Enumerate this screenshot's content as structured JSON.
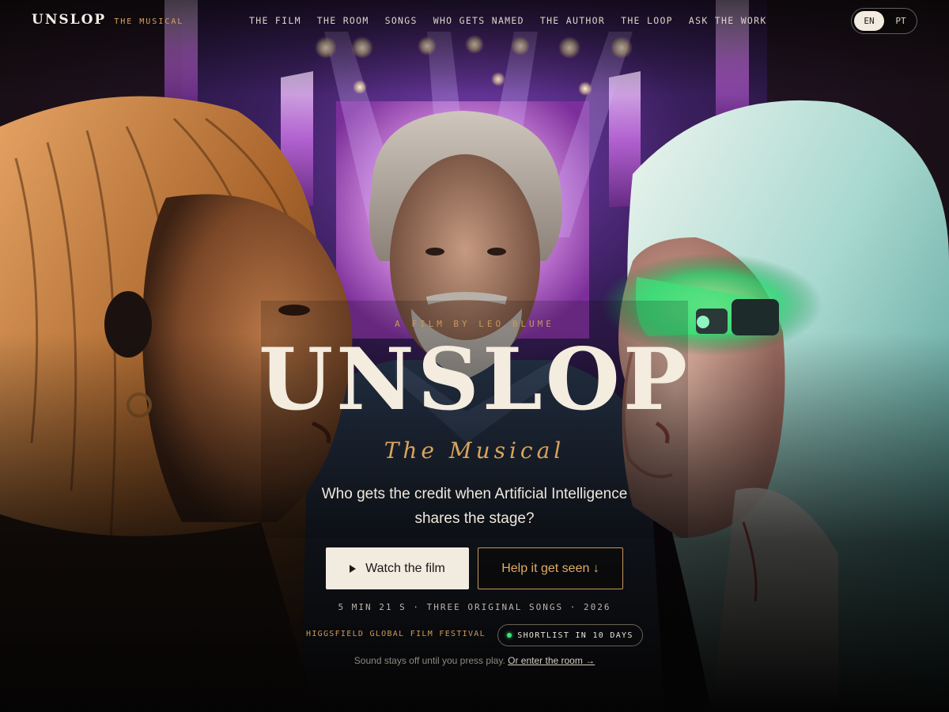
{
  "brand": {
    "name": "UNSLOP",
    "sub": "THE MUSICAL"
  },
  "nav": [
    {
      "label": "THE FILM"
    },
    {
      "label": "THE ROOM"
    },
    {
      "label": "SONGS"
    },
    {
      "label": "WHO GETS NAMED"
    },
    {
      "label": "THE AUTHOR"
    },
    {
      "label": "THE LOOP"
    },
    {
      "label": "ASK THE WORK"
    }
  ],
  "lang": {
    "active": "EN",
    "other": "PT"
  },
  "hero": {
    "kicker": "A FILM BY LEO BLUME",
    "title": "UNSLOP",
    "subtitle": "The Musical",
    "tagline": "Who gets the credit when Artificial Intelligence shares the stage?"
  },
  "actions": {
    "watch_label": "Watch the film",
    "help_label": "Help it get seen ↓"
  },
  "meta": "5 MIN 21 S · THREE ORIGINAL SONGS · 2026",
  "festival": {
    "name": "HIGGSFIELD GLOBAL FILM FESTIVAL",
    "status": "SHORTLIST IN 10 DAYS"
  },
  "note": {
    "text": "Sound stays off until you press play.",
    "link": "Or enter the room →"
  },
  "icons": [
    "play-icon",
    "live-dot-icon",
    "down-arrow-icon",
    "right-arrow-icon"
  ],
  "colors": {
    "accent": "#d9a45c",
    "cream": "#f1ebe0",
    "live": "#3de37a",
    "background": "#050404"
  }
}
